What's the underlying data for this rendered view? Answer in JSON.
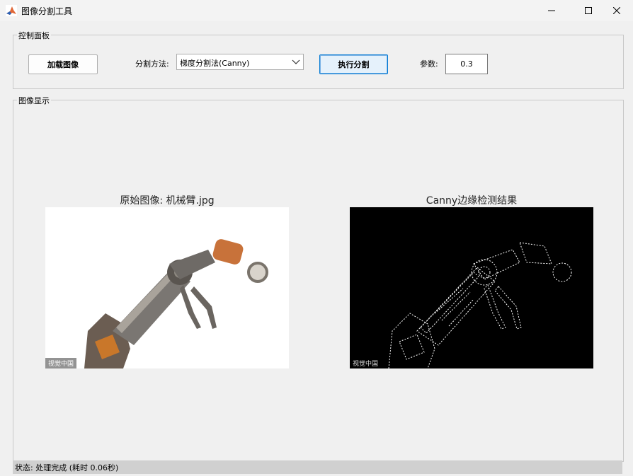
{
  "window": {
    "title": "图像分割工具",
    "icons": {
      "app": "matlab-icon",
      "minimize": "minimize-icon",
      "maximize": "maximize-icon",
      "close": "close-icon"
    }
  },
  "control_panel": {
    "legend": "控制面板",
    "load_button": "加载图像",
    "method_label": "分割方法:",
    "method_value": "梯度分割法(Canny)",
    "execute_button": "执行分割",
    "param_label": "参数:",
    "param_value": "0.3"
  },
  "display_panel": {
    "legend": "图像显示",
    "original_title": "原始图像: 机械臂.jpg",
    "original_watermark": "视觉中国",
    "result_title": "Canny边缘检测结果",
    "result_watermark": "视觉中国"
  },
  "status": {
    "text": "状态: 处理完成 (耗时 0.06秒)"
  }
}
